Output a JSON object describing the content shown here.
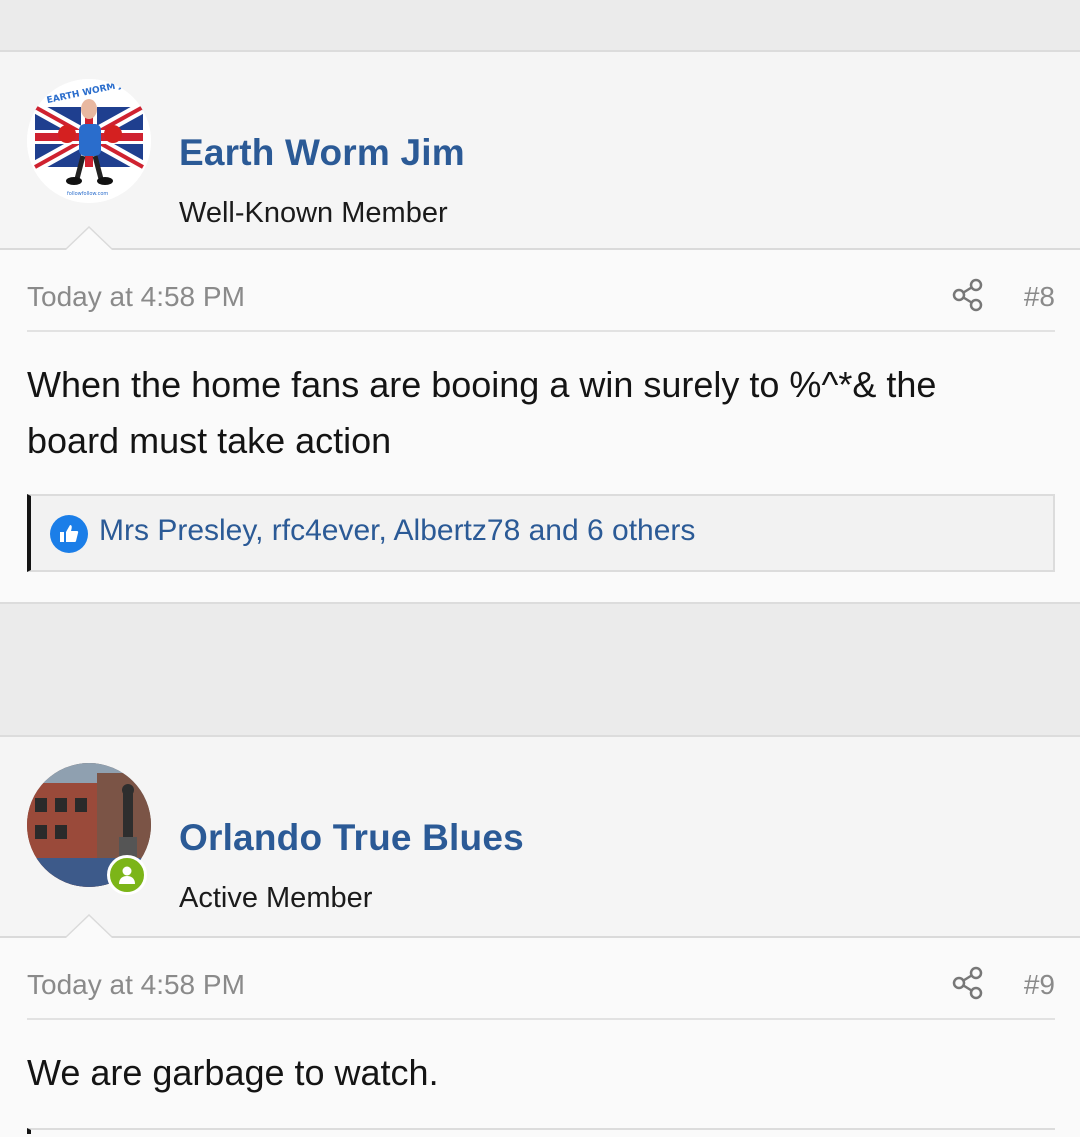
{
  "posts": [
    {
      "username": "Earth Worm Jim",
      "user_title": "Well-Known Member",
      "avatar": "earth-worm-jim-avatar",
      "online": false,
      "timestamp": "Today at 4:58 PM",
      "post_number": "#8",
      "message": "When the home fans are booing a win surely to %^*& the board must take action",
      "reactions": "Mrs Presley, rfc4ever, Albertz78 and 6 others"
    },
    {
      "username": "Orlando True Blues",
      "user_title": "Active Member",
      "avatar": "stadium-statue-avatar",
      "online": true,
      "timestamp": "Today at 4:58 PM",
      "post_number": "#9",
      "message": "We are garbage to watch."
    }
  ],
  "icons": {
    "share": "share-icon",
    "like": "like-icon",
    "online": "online-user-icon"
  },
  "colors": {
    "username": "#2b5a96",
    "like": "#1b7ee8",
    "online": "#7cb518"
  }
}
